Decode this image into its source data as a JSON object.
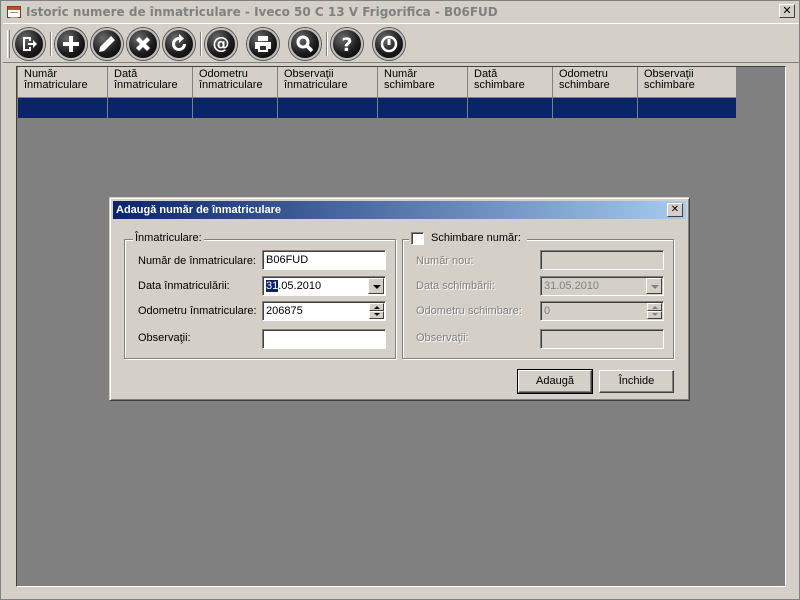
{
  "window": {
    "title": "Istoric numere de înmatriculare - Iveco 50 C 13 V Frigorifica - B06FUD",
    "close_glyph": "✕"
  },
  "toolbar": {
    "buttons": [
      {
        "name": "exit",
        "icon": "exit-icon"
      },
      {
        "name": "add",
        "icon": "plus-icon"
      },
      {
        "name": "edit",
        "icon": "pencil-icon"
      },
      {
        "name": "delete",
        "icon": "x-icon"
      },
      {
        "name": "refresh",
        "icon": "refresh-icon"
      },
      {
        "name": "email",
        "icon": "at-icon"
      },
      {
        "name": "print",
        "icon": "printer-icon"
      },
      {
        "name": "search",
        "icon": "magnifier-icon"
      },
      {
        "name": "help",
        "icon": "question-icon"
      },
      {
        "name": "info",
        "icon": "power-icon"
      }
    ]
  },
  "grid": {
    "columns": [
      "Număr\nînmatriculare",
      "Dată\nînmatriculare",
      "Odometru\nînmatriculare",
      "Observaţii\nînmatriculare",
      "Număr\nschimbare",
      "Dată\nschimbare",
      "Odometru\nschimbare",
      "Observaţii\nschimbare"
    ]
  },
  "dialog": {
    "title": "Adaugă număr de înmatriculare",
    "close_glyph": "✕",
    "registration": {
      "legend": "Înmatriculare:",
      "number_label": "Număr de înmatriculare:",
      "number_value": "B06FUD",
      "date_label": "Data înmatriculării:",
      "date_selected": "31",
      "date_rest": ".05.2010",
      "odometer_label": "Odometru înmatriculare:",
      "odometer_value": "206875",
      "notes_label": "Observaţii:",
      "notes_value": ""
    },
    "change": {
      "legend": "Schimbare număr:",
      "checked": false,
      "new_number_label": "Număr nou:",
      "new_number_value": "",
      "date_label": "Data schimbării:",
      "date_value": "31.05.2010",
      "odometer_label": "Odometru schimbare:",
      "odometer_value": "0",
      "notes_label": "Observaţii:",
      "notes_value": ""
    },
    "add_button": "Adaugă",
    "close_button": "Închide"
  },
  "colors": {
    "selection": "#0a246a",
    "dialog_title_start": "#0a246a",
    "dialog_title_end": "#a6caf0",
    "grid_background": "#808080"
  }
}
